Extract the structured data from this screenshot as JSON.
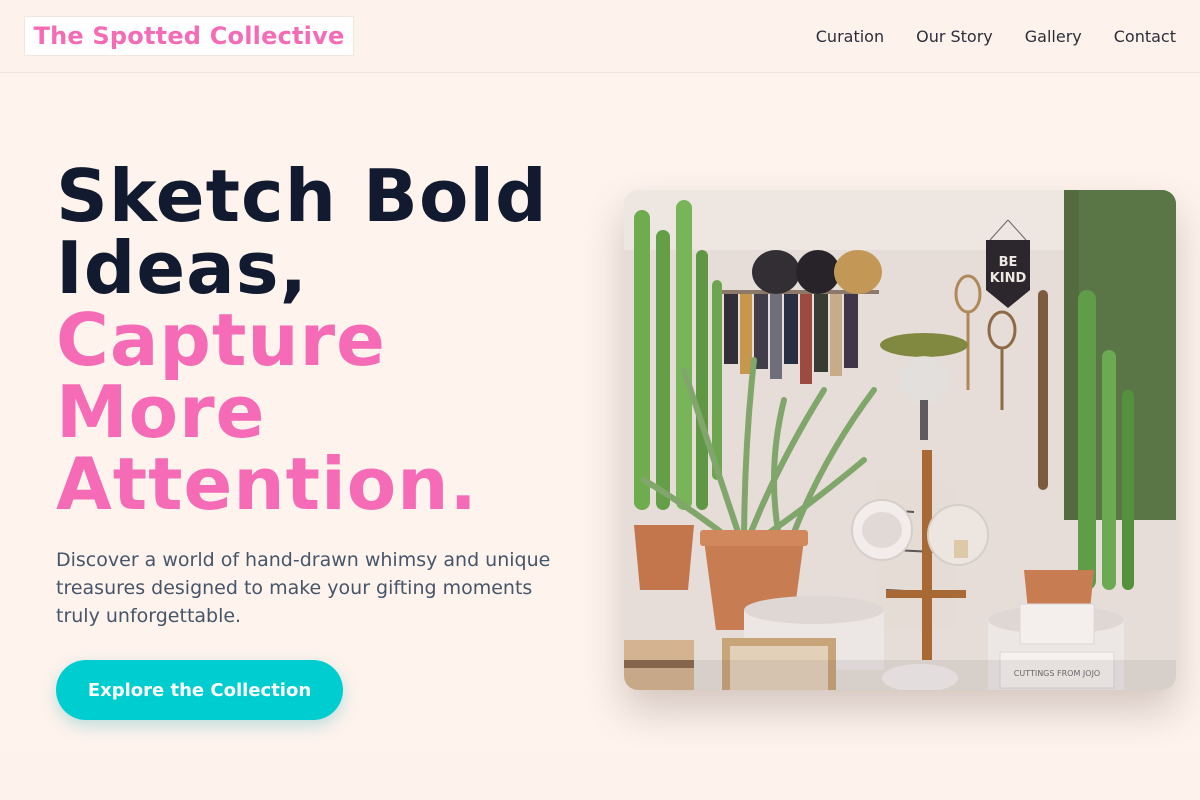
{
  "header": {
    "logo": "The Spotted Collective",
    "nav": [
      "Curation",
      "Our Story",
      "Gallery",
      "Contact"
    ]
  },
  "hero": {
    "headline_line1": "Sketch Bold",
    "headline_line2": "Ideas,",
    "headline_accent_line1": "Capture",
    "headline_accent_line2": "More",
    "headline_accent_line3": "Attention.",
    "subtitle": "Discover a world of hand-drawn whimsy and unique treasures designed to make your gifting moments truly unforgettable.",
    "cta_label": "Explore the Collection"
  },
  "photo": {
    "banner_text_line1": "BE",
    "banner_text_line2": "KIND",
    "label_text": "CUTTINGS FROM JOJO"
  },
  "colors": {
    "accent_pink": "#f66bb5",
    "cta_teal": "#00cdd0",
    "headline_dark": "#111a2e",
    "background": "#fdf3ec"
  }
}
